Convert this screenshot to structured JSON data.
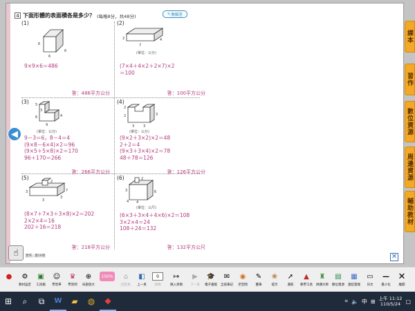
{
  "question": {
    "number": "4",
    "title": "下面形體的表面積各是多少？",
    "score": "(每格8分，共48分)",
    "answer_button": "教解答"
  },
  "problems": [
    {
      "label": "(1)",
      "unit": "",
      "dims": [
        "6",
        "6",
        "6"
      ],
      "work": "9×9×6＝486",
      "answer": "答：486平方公分"
    },
    {
      "label": "(2)",
      "unit": "(單位：公分)",
      "dims": [
        "2",
        "4",
        "7"
      ],
      "work": "(7×4＋4×2＋2×7)×2\n＝100",
      "answer": "答：100平方公分"
    },
    {
      "label": "(3)",
      "unit": "(單位：公分)",
      "dims": [
        "5",
        "3",
        "6",
        "4",
        "9"
      ],
      "work": "9－3＝6，8－4＝4\n(9×8－6×4)×2＝96\n(9×5＋5×8)×2＝170\n96＋170＝266",
      "answer": "答：266平方公分"
    },
    {
      "label": "(4)",
      "unit": "(單位：公分)",
      "dims": [
        "2",
        "2",
        "3",
        "3",
        "3"
      ],
      "work": "(9×2＋3×2)×2＝48\n2＋2＝4\n(9×3＋3×4)×2＝78\n48＋78＝126",
      "answer": "答：126平方公分"
    },
    {
      "label": "(5)",
      "unit": "(單位：公分)",
      "dims": [
        "2",
        "3",
        "7",
        "3",
        "3"
      ],
      "work": "(8×7＋7×3＋3×8)×2＝202\n2×2×4＝16\n202＋16＝218",
      "answer": "答：218平方公分"
    },
    {
      "label": "(6)",
      "unit": "(單位：公尺)",
      "dims": [
        "2",
        "3",
        "6",
        "4",
        "4"
      ],
      "work": "(6×3＋3×4＋4×6)×2＝108\n3×2×4＝24\n108＋24＝132",
      "answer": "答：132平方公尺"
    }
  ],
  "side_tabs": [
    "課本",
    "習作",
    "數位資源",
    "周邊資源",
    "輔助教材"
  ],
  "page_info": "習作…第16頁",
  "toolbar": {
    "items": [
      "",
      "教材設定",
      "工具箱",
      "學習單",
      "學習吧",
      "局部放大",
      "",
      "回首頁",
      "上一頁",
      "頁碼",
      "跳入頁碼",
      "下一頁",
      "電子書版",
      "全班筆記",
      "老空間",
      "畫筆",
      "提示",
      "選取",
      "教學工具",
      "拼讀大師",
      "數位資源",
      "連結雲端",
      "日文",
      "最小化",
      "離開"
    ],
    "zoom": "100%",
    "page_number": "0"
  },
  "taskbar": {
    "apps": [
      "windows-logo",
      "search",
      "task-view",
      "word",
      "explorer",
      "chrome",
      "viewer"
    ],
    "ime": "中",
    "time": "上午 11:12",
    "date": "110/5/24"
  }
}
